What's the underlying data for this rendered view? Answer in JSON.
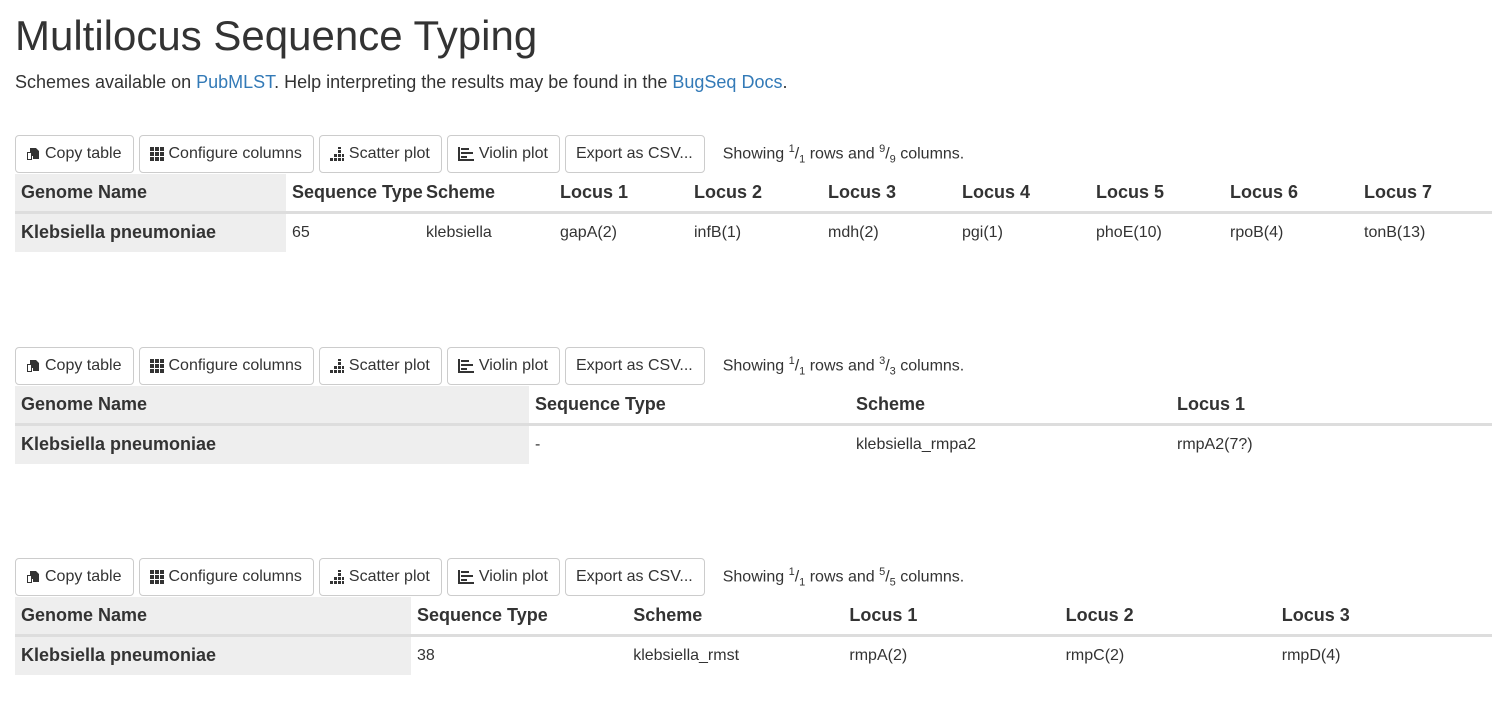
{
  "page": {
    "title": "Multilocus Sequence Typing",
    "intro_prefix": "Schemes available on ",
    "intro_link1": "PubMLST",
    "intro_middle": ". Help interpreting the results may be found in the ",
    "intro_link2": "BugSeq Docs",
    "intro_suffix": "."
  },
  "toolbar": {
    "copy_label": "Copy table",
    "configure_label": "Configure columns",
    "scatter_label": "Scatter plot",
    "violin_label": "Violin plot",
    "export_label": "Export as CSV...",
    "showing_prefix": "Showing ",
    "rows_suffix": " rows and ",
    "columns_suffix": " columns."
  },
  "tables": [
    {
      "rows_shown": "1",
      "rows_total": "1",
      "cols_shown": "9",
      "cols_total": "9",
      "headers": [
        "Genome Name",
        "Sequence Type",
        "Scheme",
        "Locus 1",
        "Locus 2",
        "Locus 3",
        "Locus 4",
        "Locus 5",
        "Locus 6",
        "Locus 7"
      ],
      "row": [
        "Klebsiella pneumoniae",
        "65",
        "klebsiella",
        "gapA(2)",
        "infB(1)",
        "mdh(2)",
        "pgi(1)",
        "phoE(10)",
        "rpoB(4)",
        "tonB(13)"
      ]
    },
    {
      "rows_shown": "1",
      "rows_total": "1",
      "cols_shown": "3",
      "cols_total": "3",
      "headers": [
        "Genome Name",
        "Sequence Type",
        "Scheme",
        "Locus 1"
      ],
      "row": [
        "Klebsiella pneumoniae",
        "-",
        "klebsiella_rmpa2",
        "rmpA2(7?)"
      ]
    },
    {
      "rows_shown": "1",
      "rows_total": "1",
      "cols_shown": "5",
      "cols_total": "5",
      "headers": [
        "Genome Name",
        "Sequence Type",
        "Scheme",
        "Locus 1",
        "Locus 2",
        "Locus 3"
      ],
      "row": [
        "Klebsiella pneumoniae",
        "38",
        "klebsiella_rmst",
        "rmpA(2)",
        "rmpC(2)",
        "rmpD(4)"
      ]
    }
  ],
  "colors": {
    "link": "#337ab7",
    "header_cell_bg": "#eeeeee",
    "border": "#cccccc"
  }
}
